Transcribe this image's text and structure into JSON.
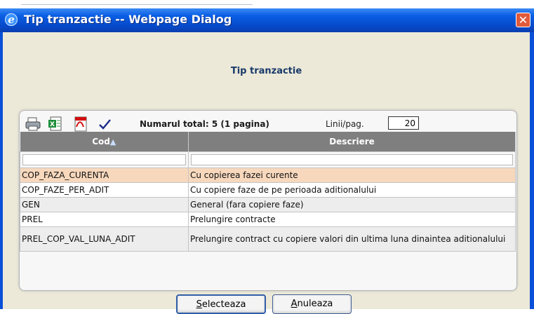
{
  "window": {
    "title": "Tip tranzactie -- Webpage Dialog",
    "icon": "ie-icon",
    "close_label": "✕"
  },
  "dialog": {
    "heading": "Tip tranzactie",
    "toolbar": {
      "icons": [
        "printer-icon",
        "excel-icon",
        "pdf-icon",
        "checkmark-icon"
      ],
      "total_text": "Numarul total: 5 (1 pagina)",
      "rows_per_page_label": "Linii/pag.",
      "rows_per_page_value": "20"
    },
    "grid": {
      "columns": [
        "Cod",
        "Descriere"
      ],
      "sort_indicator": "▲",
      "rows": [
        {
          "cod": "COP_FAZA_CURENTA",
          "descriere": "Cu copierea fazei curente",
          "selected": true
        },
        {
          "cod": "COP_FAZE_PER_ADIT",
          "descriere": "Cu copiere faze de pe perioada aditionalului"
        },
        {
          "cod": "GEN",
          "descriere": "General (fara copiere faze)"
        },
        {
          "cod": "PREL",
          "descriere": "Prelungire contracte"
        },
        {
          "cod": "PREL_COP_VAL_LUNA_ADIT",
          "descriere": "Prelungire contract cu copiere valori din ultima luna dinaintea aditionalului"
        }
      ]
    },
    "buttons": {
      "select_label": "Selecteaza",
      "select_key": "S",
      "cancel_label": "Anuleaza",
      "cancel_key": "A"
    }
  },
  "colors": {
    "titlebar": "#0649c9",
    "header": "#7f7f7f",
    "selected_row": "#f7d8bd"
  }
}
